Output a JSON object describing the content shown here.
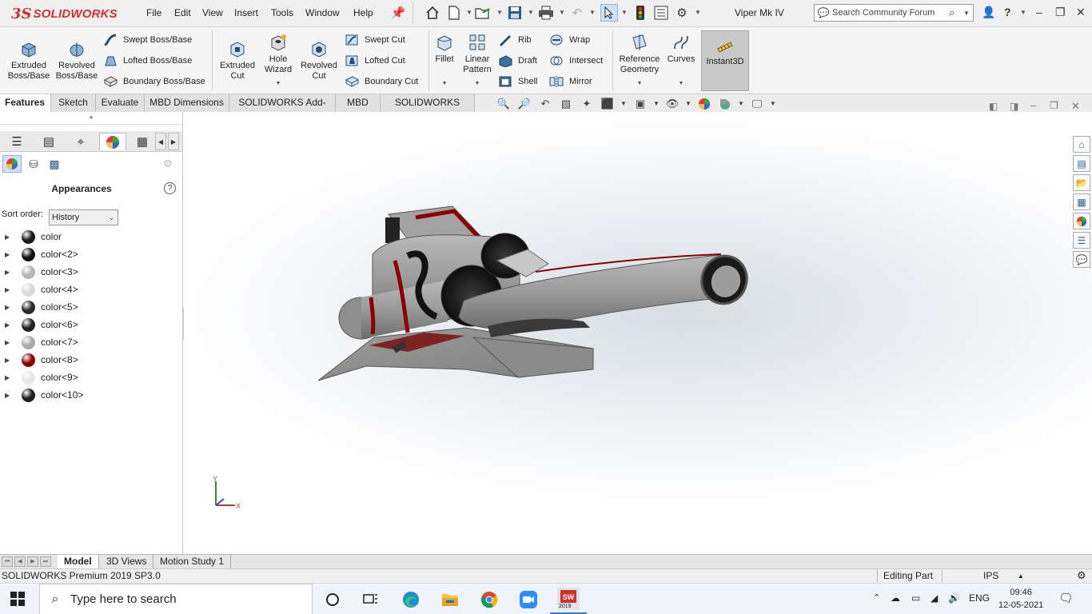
{
  "app": {
    "brand_ds": "3S",
    "brand_name": "SOLIDWORKS",
    "document_title": "Viper Mk IV"
  },
  "menu": [
    "File",
    "Edit",
    "View",
    "Insert",
    "Tools",
    "Window",
    "Help"
  ],
  "search": {
    "placeholder": "Search Community Forum"
  },
  "ribbon": {
    "extruded_boss": "Extruded Boss/Base",
    "revolved_boss": "Revolved Boss/Base",
    "swept_boss": "Swept Boss/Base",
    "lofted_boss": "Lofted Boss/Base",
    "boundary_boss": "Boundary Boss/Base",
    "extruded_cut": "Extruded Cut",
    "hole_wizard": "Hole Wizard",
    "revolved_cut": "Revolved Cut",
    "swept_cut": "Swept Cut",
    "lofted_cut": "Lofted Cut",
    "boundary_cut": "Boundary Cut",
    "fillet": "Fillet",
    "linear_pattern": "Linear Pattern",
    "rib": "Rib",
    "draft": "Draft",
    "shell": "Shell",
    "wrap": "Wrap",
    "intersect": "Intersect",
    "mirror": "Mirror",
    "reference_geometry": "Reference Geometry",
    "curves": "Curves",
    "instant3d": "Instant3D"
  },
  "command_tabs": [
    "Features",
    "Sketch",
    "Evaluate",
    "MBD Dimensions",
    "SOLIDWORKS Add-Ins",
    "MBD",
    "SOLIDWORKS CAM"
  ],
  "panel": {
    "title": "Appearances",
    "sort_label": "Sort order:",
    "sort_value": "History",
    "items": [
      {
        "label": "color",
        "swatch": "#1a1a1a"
      },
      {
        "label": "color<2>",
        "swatch": "#111111"
      },
      {
        "label": "color<3>",
        "swatch": "#b5b5b5"
      },
      {
        "label": "color<4>",
        "swatch": "#dadada"
      },
      {
        "label": "color<5>",
        "swatch": "#2b2b2b"
      },
      {
        "label": "color<6>",
        "swatch": "#222222"
      },
      {
        "label": "color<7>",
        "swatch": "#a9a9a9"
      },
      {
        "label": "color<8>",
        "swatch": "#8b0000"
      },
      {
        "label": "color<9>",
        "swatch": "#e6e6e6"
      },
      {
        "label": "color<10>",
        "swatch": "#1e1e1e"
      }
    ]
  },
  "triad": {
    "y": "Y",
    "x": "X"
  },
  "bottom_tabs": [
    "Model",
    "3D Views",
    "Motion Study 1"
  ],
  "status": {
    "product": "SOLIDWORKS Premium 2019 SP3.0",
    "mode": "Editing Part",
    "units": "IPS"
  },
  "taskbar": {
    "search_placeholder": "Type here to search",
    "lang": "ENG",
    "time": "09:46",
    "date": "12-05-2021",
    "sw_badge": "2019"
  }
}
